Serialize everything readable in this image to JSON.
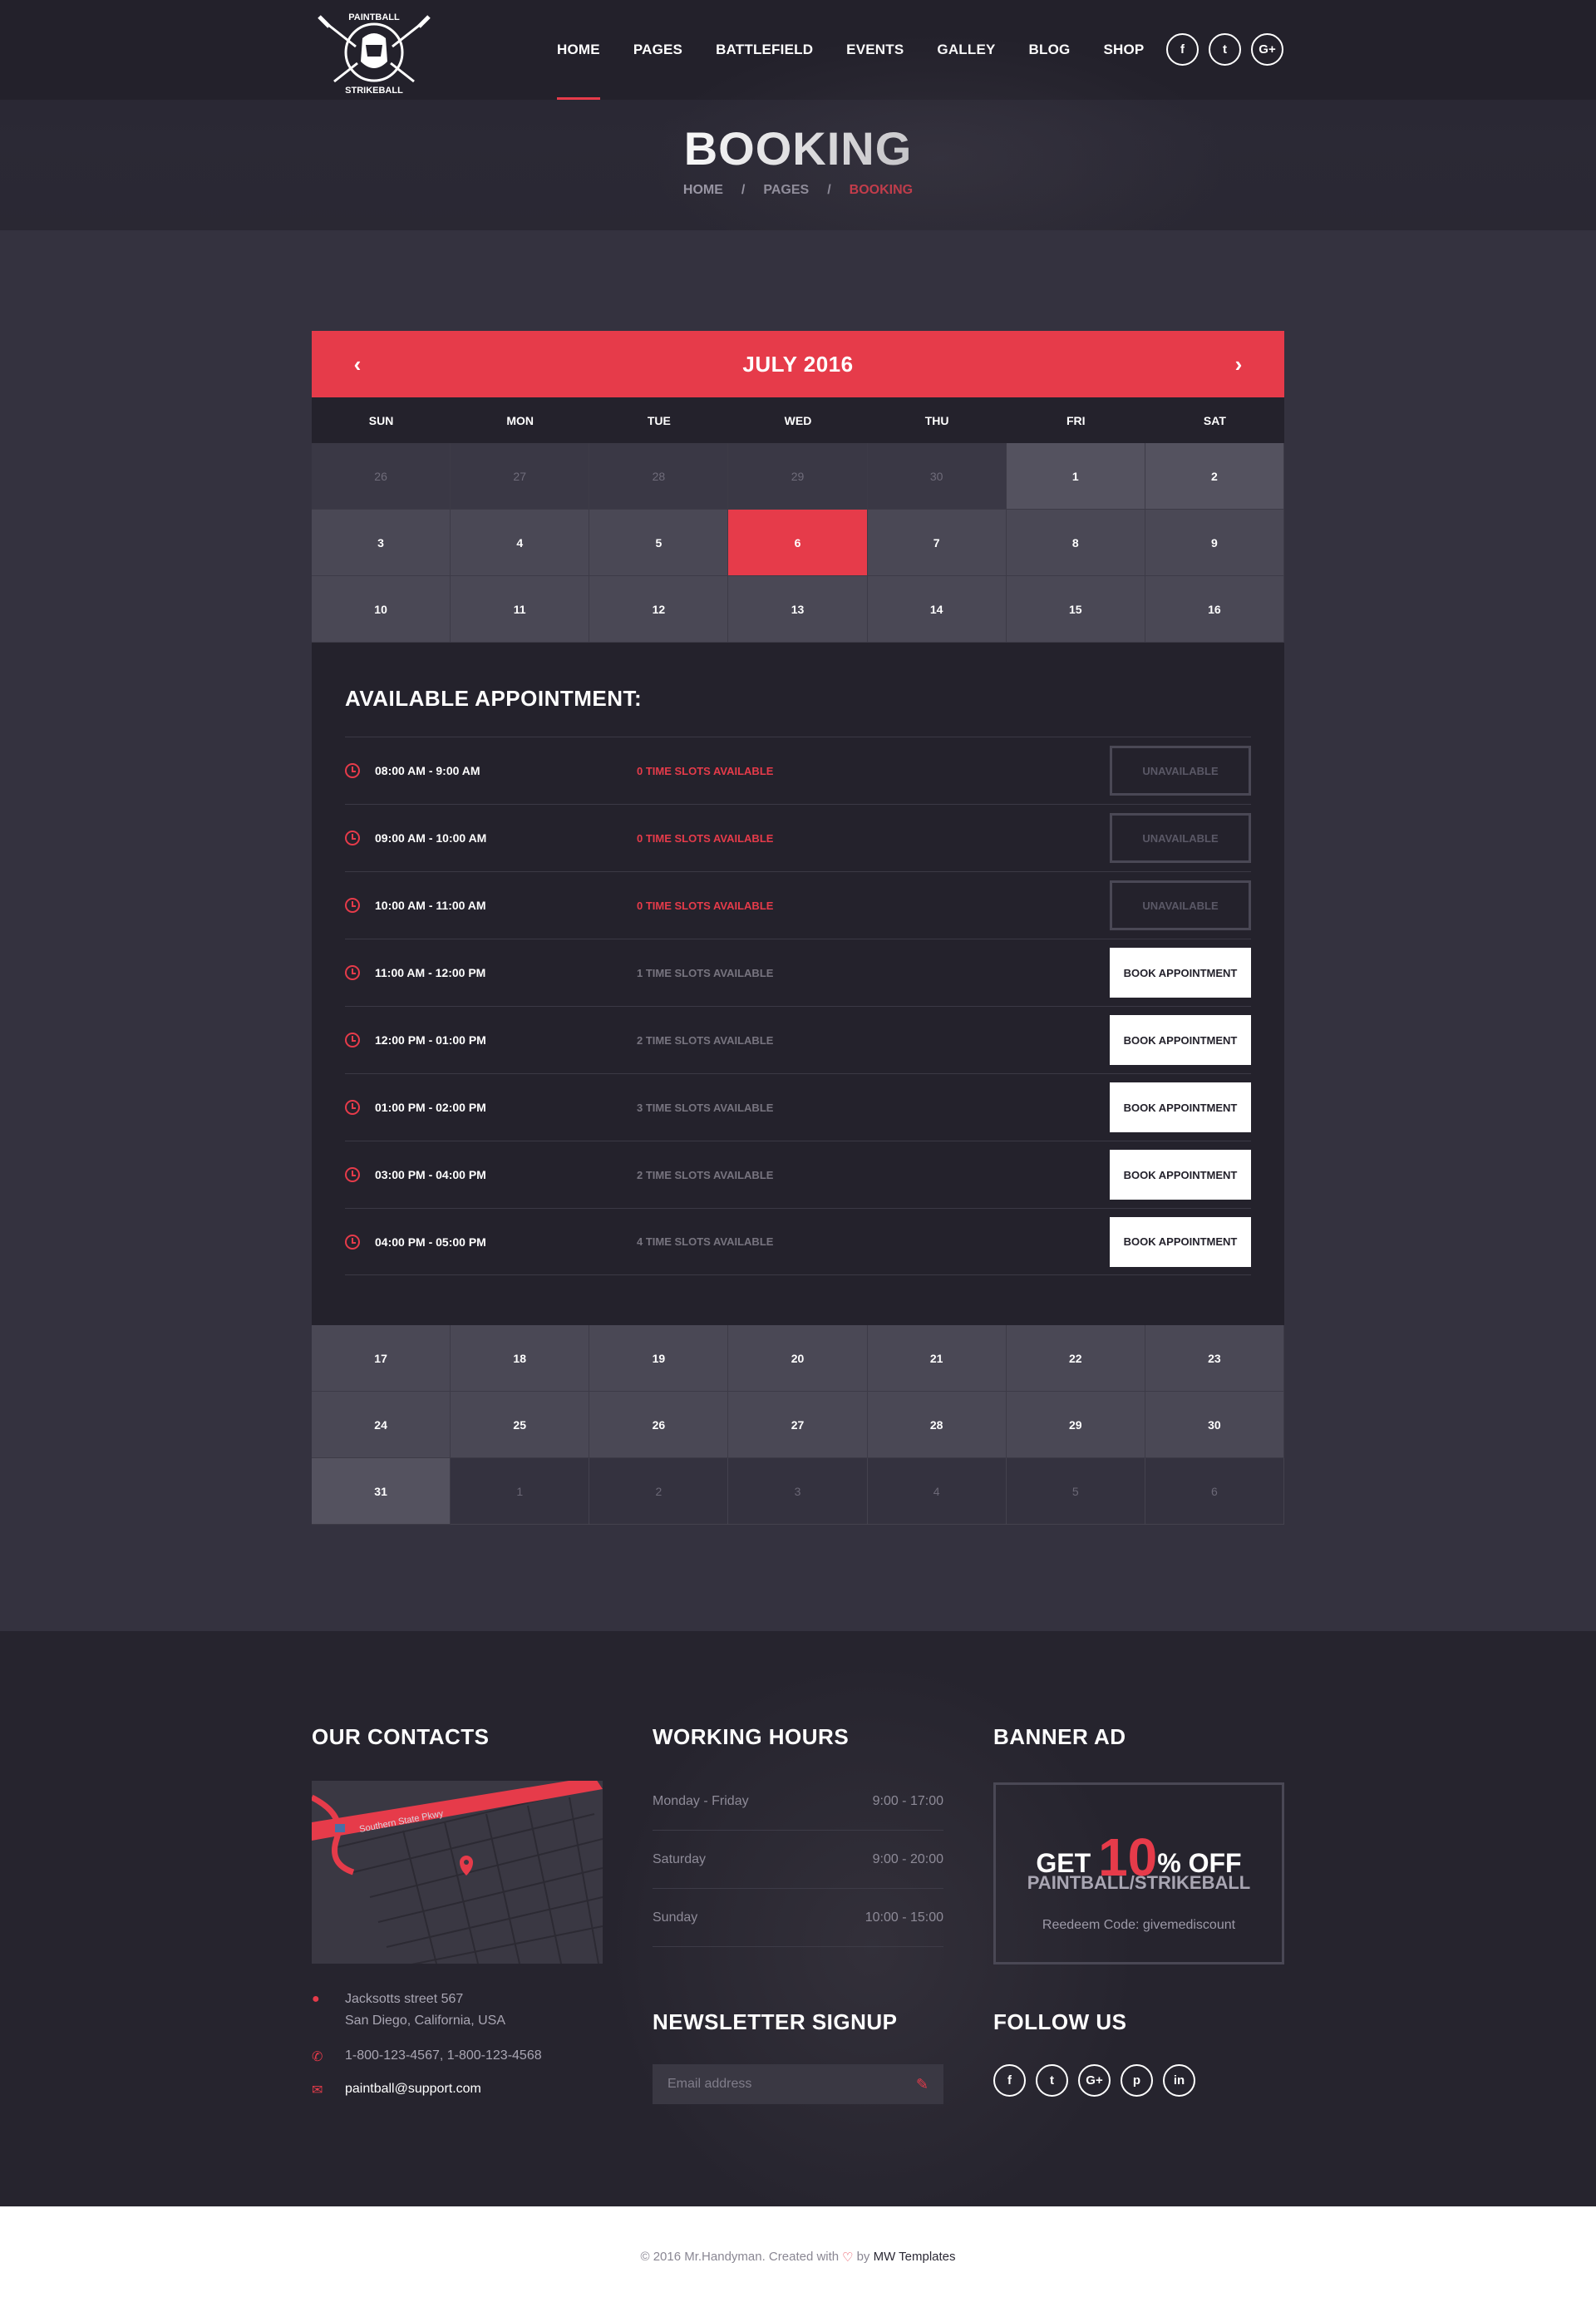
{
  "nav": {
    "items": [
      "HOME",
      "PAGES",
      "BATTLEFIELD",
      "EVENTS",
      "GALLEY",
      "BLOG",
      "SHOP"
    ],
    "social": [
      "f",
      "t",
      "G+"
    ]
  },
  "logo": {
    "top_text": "PAINTBALL",
    "bottom_text": "STRIKEBALL"
  },
  "hero": {
    "title": "BOOKING",
    "breadcrumb": [
      "HOME",
      "PAGES",
      "BOOKING"
    ]
  },
  "calendar": {
    "month": "JULY 2016",
    "prev": "‹",
    "next": "›",
    "weekdays": [
      "SUN",
      "MON",
      "TUE",
      "WED",
      "THU",
      "FRI",
      "SAT"
    ],
    "week1": [
      "26",
      "27",
      "28",
      "29",
      "30",
      "1",
      "2"
    ],
    "week2": [
      "3",
      "4",
      "5",
      "6",
      "7",
      "8",
      "9"
    ],
    "week3": [
      "10",
      "11",
      "12",
      "13",
      "14",
      "15",
      "16"
    ],
    "week4": [
      "17",
      "18",
      "19",
      "20",
      "21",
      "22",
      "23"
    ],
    "week5": [
      "24",
      "25",
      "26",
      "27",
      "28",
      "29",
      "30"
    ],
    "week6": [
      "31",
      "1",
      "2",
      "3",
      "4",
      "5",
      "6"
    ],
    "selected_day": "6"
  },
  "appointments": {
    "title": "AVAILABLE APPOINTMENT:",
    "rows": [
      {
        "time": "08:00 AM - 9:00 AM",
        "slots": "0 TIME SLOTS AVAILABLE",
        "action": "UNAVAILABLE"
      },
      {
        "time": "09:00 AM - 10:00 AM",
        "slots": "0 TIME SLOTS AVAILABLE",
        "action": "UNAVAILABLE"
      },
      {
        "time": "10:00 AM - 11:00 AM",
        "slots": "0 TIME SLOTS AVAILABLE",
        "action": "UNAVAILABLE"
      },
      {
        "time": "11:00 AM - 12:00 PM",
        "slots": "1 TIME SLOTS AVAILABLE",
        "action": "BOOK APPOINTMENT"
      },
      {
        "time": "12:00 PM - 01:00 PM",
        "slots": "2 TIME SLOTS AVAILABLE",
        "action": "BOOK APPOINTMENT"
      },
      {
        "time": "01:00 PM - 02:00 PM",
        "slots": "3 TIME SLOTS AVAILABLE",
        "action": "BOOK APPOINTMENT"
      },
      {
        "time": "03:00 PM - 04:00 PM",
        "slots": "2 TIME SLOTS AVAILABLE",
        "action": "BOOK APPOINTMENT"
      },
      {
        "time": "04:00 PM - 05:00 PM",
        "slots": "4 TIME SLOTS AVAILABLE",
        "action": "BOOK APPOINTMENT"
      }
    ]
  },
  "footer": {
    "contacts_title": "OUR CONTACTS",
    "address_line1": "Jacksotts street 567",
    "address_line2": "San Diego, California, USA",
    "phone": "1-800-123-4567, 1-800-123-4568",
    "email": "paintball@support.com",
    "map_label": "Southern State Pkwy",
    "hours_title": "WORKING HOURS",
    "hours": [
      {
        "day": "Monday - Friday",
        "time": "9:00 - 17:00"
      },
      {
        "day": "Saturday",
        "time": "9:00 - 20:00"
      },
      {
        "day": "Sunday",
        "time": "10:00 - 15:00"
      }
    ],
    "banner_title": "BANNER AD",
    "banner_get": "GET",
    "banner_ten": "10",
    "banner_pct": "%",
    "banner_off": "OFF",
    "banner_sub": "PAINTBALL/STRIKEBALL",
    "banner_code": "Reedeem Code: givemediscount",
    "newsletter_title": "NEWSLETTER SIGNUP",
    "newsletter_placeholder": "Email address",
    "follow_title": "FOLLOW US",
    "follow_icons": [
      "f",
      "t",
      "G+",
      "p",
      "in"
    ],
    "copyright_pre": "© 2016 Mr.Handyman. Created with",
    "copyright_by": "by",
    "copyright_author": "MW Templates"
  }
}
